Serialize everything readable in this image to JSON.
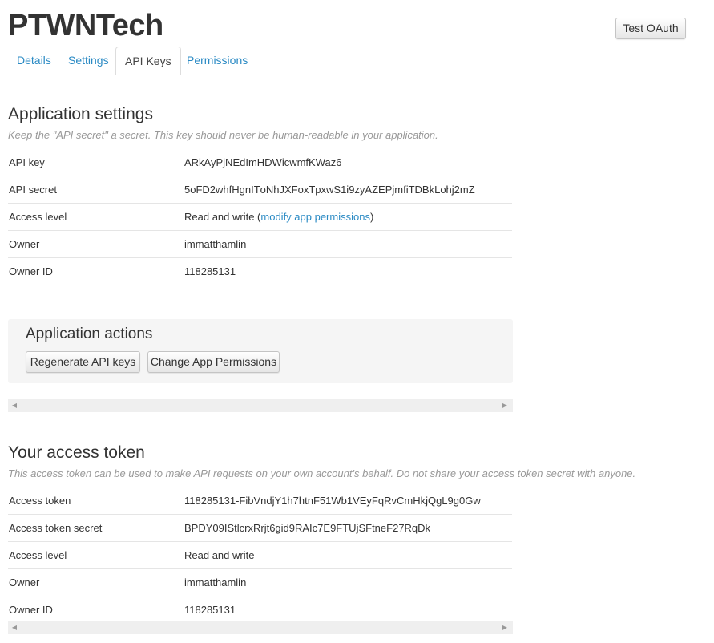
{
  "header": {
    "title": "PTWNTech",
    "test_oauth_label": "Test OAuth"
  },
  "tabs": [
    {
      "label": "Details"
    },
    {
      "label": "Settings"
    },
    {
      "label": "API Keys"
    },
    {
      "label": "Permissions"
    }
  ],
  "app_settings": {
    "title": "Application settings",
    "description": "Keep the \"API secret\" a secret. This key should never be human-readable in your application.",
    "rows": [
      {
        "key": "API key",
        "value": "ARkAyPjNEdImHDWicwmfKWaz6"
      },
      {
        "key": "API secret",
        "value": "5oFD2whfHgnITоNhJXFoxTpxwS1i9zyAZEPjmfiTDBkLohj2mZ"
      },
      {
        "key": "Access level",
        "value": "Read and write (",
        "link": "modify app permissions",
        "suffix": ")"
      },
      {
        "key": "Owner",
        "value": "immatthamlin"
      },
      {
        "key": "Owner ID",
        "value": "118285131"
      }
    ]
  },
  "app_actions": {
    "title": "Application actions",
    "regenerate_label": "Regenerate API keys",
    "change_perms_label": "Change App Permissions"
  },
  "access_token": {
    "title": "Your access token",
    "description": "This access token can be used to make API requests on your own account's behalf. Do not share your access token secret with anyone.",
    "rows": [
      {
        "key": "Access token",
        "value": "118285131-FibVndjY1h7htnF51Wb1VEyFqRvCmHkjQgL9g0Gw"
      },
      {
        "key": "Access token secret",
        "value": "BPDY09IStlcrxRrjt6gid9RAIc7E9FTUjSFtneF27RqDk"
      },
      {
        "key": "Access level",
        "value": "Read and write"
      },
      {
        "key": "Owner",
        "value": "immatthamlin"
      },
      {
        "key": "Owner ID",
        "value": "118285131"
      }
    ]
  },
  "icons": {
    "scroll_left": "scroll-left-arrow-icon",
    "scroll_right": "scroll-right-arrow-icon"
  }
}
